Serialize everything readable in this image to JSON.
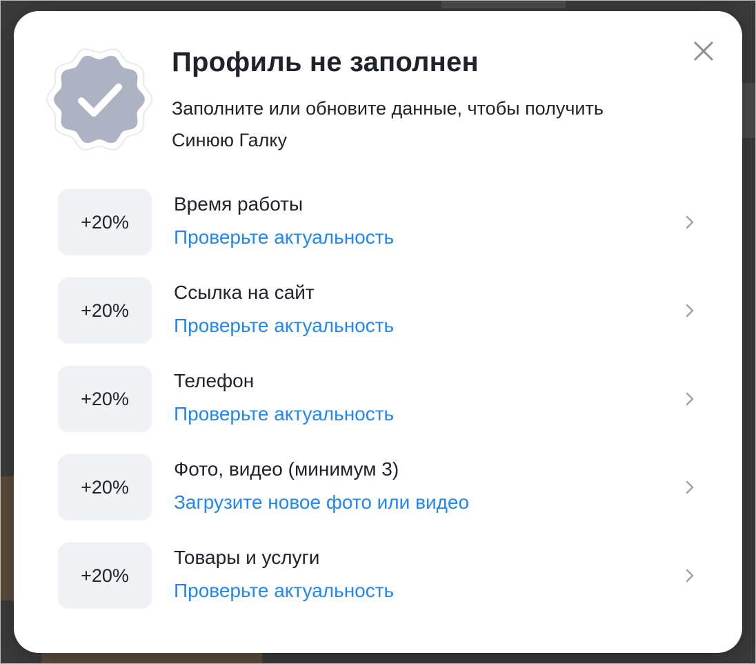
{
  "modal": {
    "title": "Профиль не заполнен",
    "subtitle": "Заполните или обновите данные, чтобы получить Синюю Галку",
    "badge_icon": "verified-badge-icon",
    "close_icon": "close-icon"
  },
  "items": [
    {
      "percent": "+20%",
      "title": "Время работы",
      "action": "Проверьте актуальность"
    },
    {
      "percent": "+20%",
      "title": "Ссылка на сайт",
      "action": "Проверьте актуальность"
    },
    {
      "percent": "+20%",
      "title": "Телефон",
      "action": "Проверьте актуальность"
    },
    {
      "percent": "+20%",
      "title": "Фото, видео (минимум 3)",
      "action": "Загрузите новое фото или видео"
    },
    {
      "percent": "+20%",
      "title": "Товары и услуги",
      "action": "Проверьте актуальность"
    }
  ],
  "colors": {
    "link": "#2286f5",
    "text": "#21232c",
    "percent_bg": "#f0f1f5",
    "badge": "#aeb3c4",
    "backdrop": "#3a3a3a"
  }
}
